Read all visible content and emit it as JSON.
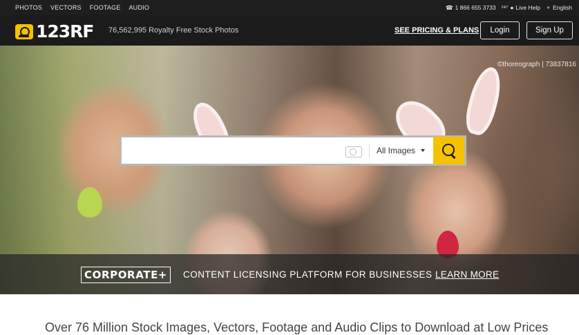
{
  "topbar": {
    "nav": [
      "PHOTOS",
      "VECTORS",
      "FOOTAGE",
      "AUDIO"
    ],
    "phone": "1 866 655 3733",
    "live_badge": "24/7",
    "live_help": "Live Help",
    "language": "English",
    "icons": [
      "phone-icon",
      "chat-icon",
      "globe-icon"
    ]
  },
  "header": {
    "logo_text": "123RF",
    "tagline": "76,562,995  Royalty Free Stock Photos",
    "pricing_link": "SEE PRICING & PLANS",
    "login_label": "Login",
    "signup_label": "Sign Up"
  },
  "hero": {
    "photo_credit": "©thoreograph | 73837816",
    "search": {
      "value": "",
      "placeholder": "",
      "category": "All Images",
      "icons": [
        "camera-icon",
        "search-icon"
      ]
    }
  },
  "banner": {
    "badge": "CORPORATE+",
    "text": "CONTENT LICENSING PLATFORM FOR BUSINESSES",
    "cta": "LEARN MORE"
  },
  "below": {
    "text": "Over 76 Million Stock Images, Vectors, Footage and Audio Clips to Download at Low Prices"
  },
  "colors": {
    "accent": "#f5c200",
    "header_bg": "#1b1b1b",
    "topbar_bg": "#1e1e1e"
  }
}
